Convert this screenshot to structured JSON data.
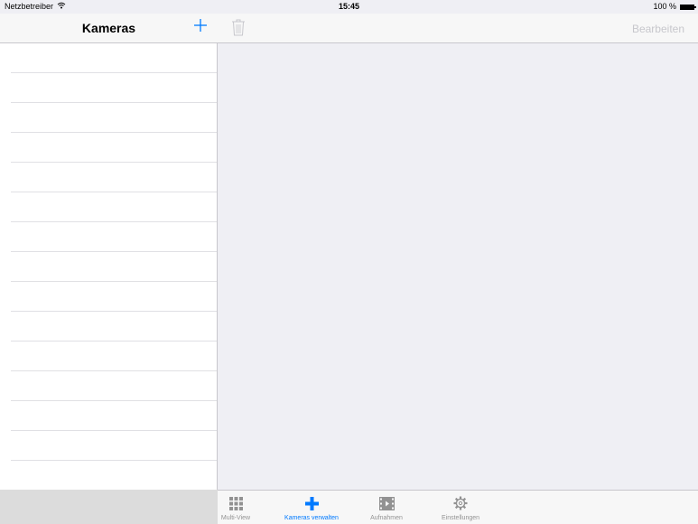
{
  "status_bar": {
    "carrier": "Netzbetreiber",
    "time": "15:45",
    "battery": "100 %"
  },
  "master": {
    "title": "Kameras",
    "row_count": 15
  },
  "detail": {
    "edit_label": "Bearbeiten"
  },
  "tab_bar": {
    "tabs": [
      {
        "label": "Multi-View",
        "icon": "grid-icon",
        "active": false
      },
      {
        "label": "Kameras verwalten",
        "icon": "plus-icon",
        "active": true
      },
      {
        "label": "Aufnahmen",
        "icon": "film-icon",
        "active": false
      },
      {
        "label": "Einstellungen",
        "icon": "gear-icon",
        "active": false
      }
    ]
  },
  "colors": {
    "accent": "#007aff",
    "inactive": "#929292",
    "disabled": "#c7c7cc",
    "background": "#efeff4"
  }
}
